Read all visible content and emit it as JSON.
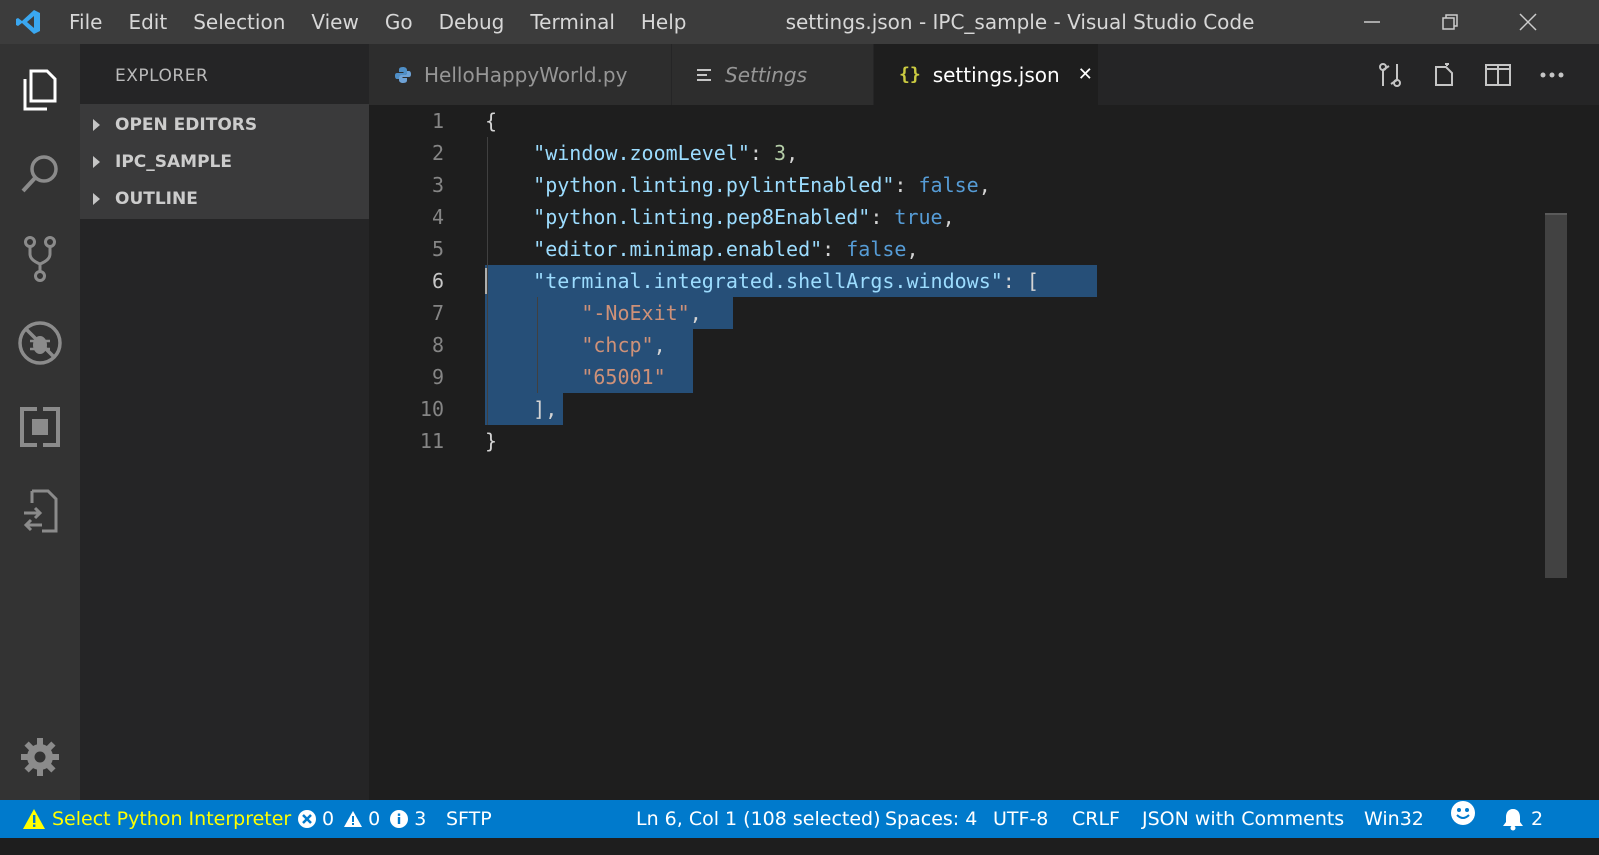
{
  "titlebar": {
    "menu": [
      "File",
      "Edit",
      "Selection",
      "View",
      "Go",
      "Debug",
      "Terminal",
      "Help"
    ],
    "title": "settings.json - IPC_sample - Visual Studio Code"
  },
  "activity_bar": {
    "items": [
      "explorer-icon",
      "search-icon",
      "source-control-icon",
      "debug-icon",
      "extensions-icon",
      "remote-explorer-icon"
    ],
    "bottom": "gear-icon"
  },
  "sidebar": {
    "title": "EXPLORER",
    "sections": [
      "OPEN EDITORS",
      "IPC_SAMPLE",
      "OUTLINE"
    ]
  },
  "tabs": [
    {
      "label": "HelloHappyWorld.py",
      "icon": "python-icon"
    },
    {
      "label": "Settings",
      "icon": "settings-list-icon"
    },
    {
      "label": "settings.json",
      "icon": "json-braces-icon",
      "close": "✕"
    }
  ],
  "editor": {
    "line_numbers": [
      "1",
      "2",
      "3",
      "4",
      "5",
      "6",
      "7",
      "8",
      "9",
      "10",
      "11"
    ],
    "active_line": "6"
  },
  "statusbar": {
    "python": "Select Python Interpreter",
    "errors": "0",
    "warnings": "0",
    "infos": "3",
    "sftp": "SFTP",
    "position": "Ln 6, Col 1 (108 selected)",
    "spaces": "Spaces: 4",
    "encoding": "UTF-8",
    "eol": "CRLF",
    "language": "JSON with Comments",
    "platform": "Win32",
    "notifications": "2"
  },
  "colors": {
    "status_bar": "#007acc",
    "selection": "#264f78",
    "json_key": "#9cdcfe",
    "string": "#ce9178",
    "number": "#b5cea8",
    "boolean": "#569cd6"
  }
}
